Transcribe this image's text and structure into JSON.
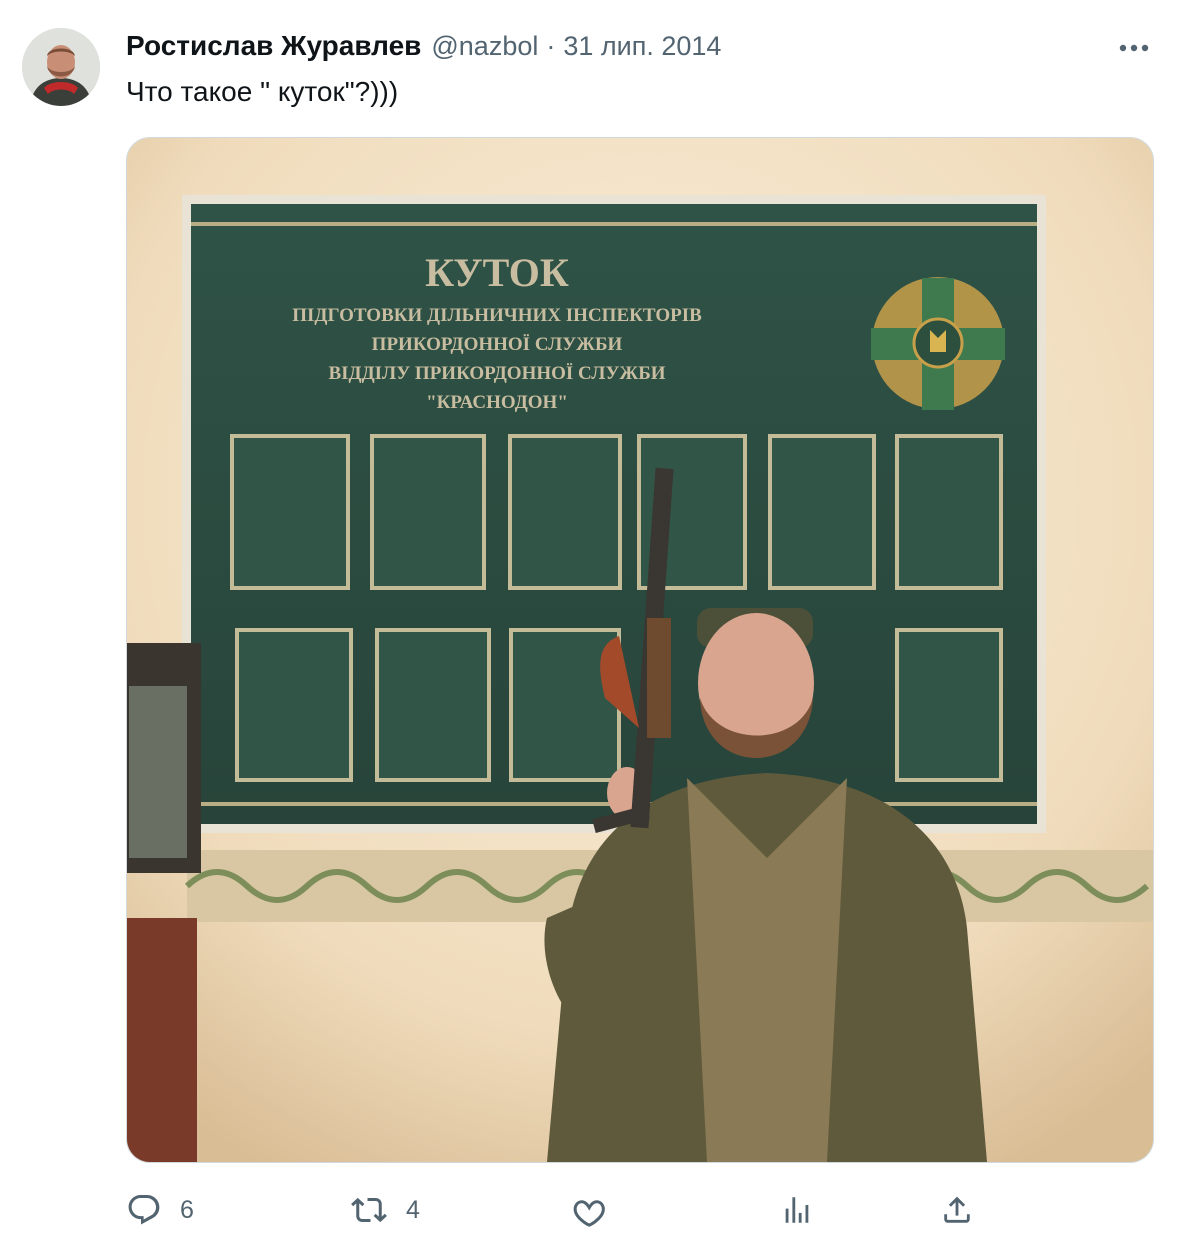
{
  "tweet": {
    "author_name": "Ростислав Журавлев",
    "handle": "@nazbol",
    "separator": "·",
    "date": "31 лип. 2014",
    "text": "Что такое \" куток\"?)))"
  },
  "media": {
    "board_title": "КУТОК",
    "board_lines": [
      "ПІДГОТОВКИ ДІЛЬНИЧНИХ ІНСПЕКТОРІВ",
      "ПРИКОРДОННОЇ СЛУЖБИ",
      "ВІДДІЛУ ПРИКОРДОННОЇ СЛУЖБИ",
      "\"КРАСНОДОН\""
    ]
  },
  "actions": {
    "reply_count": "6",
    "retweet_count": "4",
    "like_count": "",
    "views_count": ""
  },
  "icons": {
    "more": "more-dots-icon",
    "reply": "reply-bubble-icon",
    "retweet": "retweet-arrows-icon",
    "like": "heart-icon",
    "views": "bar-chart-icon",
    "share": "share-upload-icon"
  },
  "colors": {
    "text_primary": "#0f1419",
    "text_secondary": "#536471",
    "board_green": "#2f4d40"
  }
}
